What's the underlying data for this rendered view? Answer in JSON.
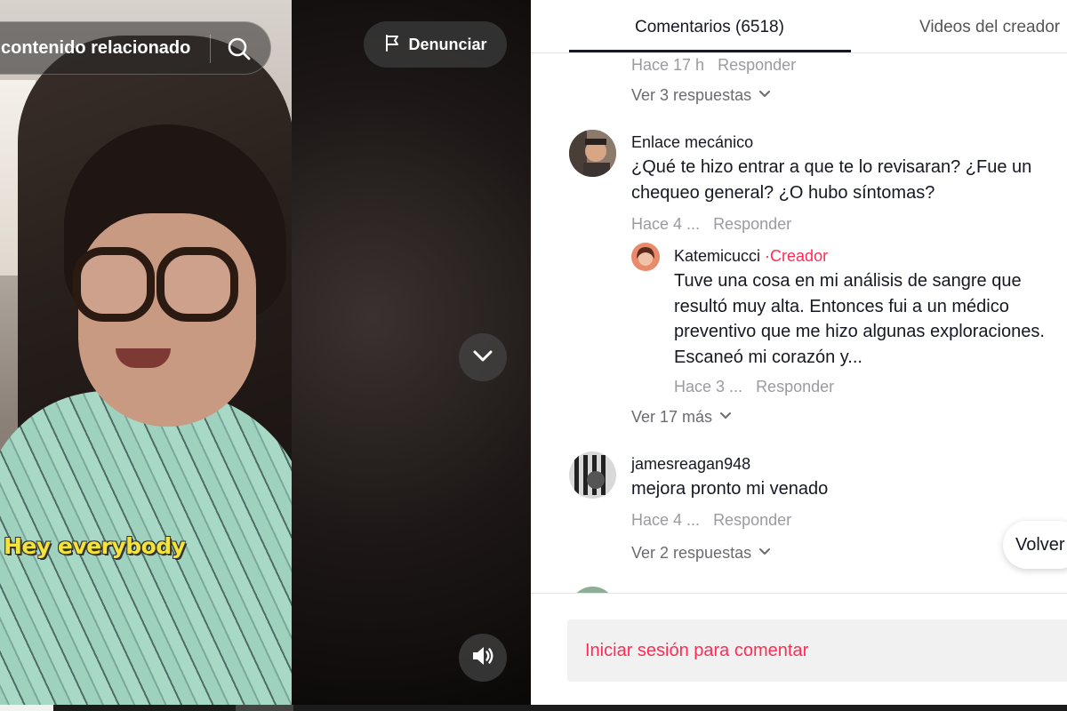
{
  "video": {
    "search_text": "contenido relacionado",
    "report_label": "Denunciar",
    "subtitle": "Hey everybody",
    "icons": {
      "search": "search-icon",
      "report": "flag-icon",
      "next": "chevron-down-icon",
      "sound": "volume-icon"
    },
    "progress_fraction": 0.05
  },
  "tabs": [
    {
      "label": "Comentarios (6518)",
      "active": true
    },
    {
      "label": "Videos del creador",
      "active": false
    }
  ],
  "comments": {
    "top_meta": {
      "time": "Hace 17 h",
      "reply": "Responder"
    },
    "top_more": "Ver 3 respuestas",
    "c1": {
      "user": "Enlace mecánico",
      "text": "¿Qué te hizo entrar a que te lo revisaran? ¿Fue un chequeo general? ¿O hubo síntomas?",
      "time": "Hace 4 ...",
      "reply": "Responder",
      "avatar_color": "#7a6a5e"
    },
    "c1_reply": {
      "user": "Katemicucci",
      "tag": "·Creador",
      "text": "Tuve una cosa en mi análisis de sangre que resultó muy alta. Entonces fui a un médico preventivo que me hizo algunas exploraciones. Escaneó mi corazón y...",
      "time": "Hace 3 ...",
      "reply": "Responder",
      "avatar_color": "#d9674f"
    },
    "c1_more": "Ver 17 más",
    "c2": {
      "user": "jamesreagan948",
      "text": "mejora pronto mi venado",
      "time": "Hace 4 ...",
      "reply": "Responder",
      "avatar_color": "#3a3a3a"
    },
    "c2_more": "Ver 2 respuestas"
  },
  "volver_label": "Volver",
  "login_prompt": "Iniciar sesión para comentar",
  "colors": {
    "accent": "#fe2c55",
    "text_primary": "#161823",
    "text_muted": "#9a9aa0"
  }
}
